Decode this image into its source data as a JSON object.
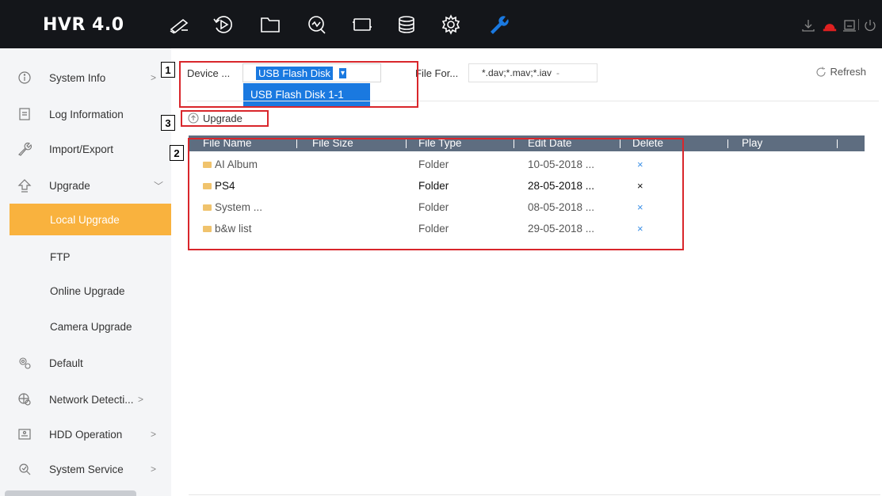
{
  "app": {
    "logo": "HVR 4.0"
  },
  "topbar": {
    "icons": [
      "live-view-icon",
      "playback-icon",
      "file-management-icon",
      "smart-analysis-icon",
      "video-wall-icon",
      "storage-icon",
      "settings-icon",
      "maintenance-icon"
    ],
    "right_icons": [
      "download-icon",
      "alarm-icon",
      "notification-icon",
      "power-icon"
    ],
    "active_color": "#1a79e0",
    "alarm_color": "#e02020"
  },
  "sidebar": {
    "items": [
      {
        "label": "System Info",
        "icon": "info-icon",
        "arrow": ">"
      },
      {
        "label": "Log Information",
        "icon": "log-icon",
        "arrow": ""
      },
      {
        "label": "Import/Export",
        "icon": "import-export-icon",
        "arrow": ""
      },
      {
        "label": "Upgrade",
        "icon": "upgrade-icon",
        "arrow": "﹀"
      },
      {
        "label": "Local Upgrade",
        "icon": "",
        "arrow": ""
      },
      {
        "label": "FTP",
        "icon": "",
        "arrow": ""
      },
      {
        "label": "Online Upgrade",
        "icon": "",
        "arrow": ""
      },
      {
        "label": "Camera Upgrade",
        "icon": "",
        "arrow": ""
      },
      {
        "label": "Default",
        "icon": "default-icon",
        "arrow": ""
      },
      {
        "label": "Network Detecti...",
        "icon": "network-detection-icon",
        "arrow": ">"
      },
      {
        "label": "HDD Operation",
        "icon": "hdd-icon",
        "arrow": ">"
      },
      {
        "label": "System Service",
        "icon": "system-service-icon",
        "arrow": ">"
      }
    ],
    "active_color": "#f9b23e"
  },
  "toolbar": {
    "device_label": "Device ...",
    "device_value": "USB Flash Disk",
    "device_option": "USB Flash Disk 1-1",
    "format_label": "File For...",
    "format_value": "*.dav;*.mav;*.iav",
    "refresh_label": "Refresh",
    "upgrade_label": "Upgrade"
  },
  "table": {
    "columns": [
      "File Name",
      "File Size",
      "File Type",
      "Edit Date",
      "Delete",
      "Play"
    ],
    "rows": [
      {
        "name": "AI Album",
        "size": "",
        "type": "Folder",
        "date": "10-05-2018 ...",
        "delete": "×"
      },
      {
        "name": "PS4",
        "size": "",
        "type": "Folder",
        "date": "28-05-2018 ...",
        "delete": "×"
      },
      {
        "name": "System ...",
        "size": "",
        "type": "Folder",
        "date": "08-05-2018 ...",
        "delete": "×"
      },
      {
        "name": "b&w list",
        "size": "",
        "type": "Folder",
        "date": "29-05-2018 ...",
        "delete": "×"
      }
    ]
  },
  "annotations": [
    {
      "number": "1"
    },
    {
      "number": "2"
    },
    {
      "number": "3"
    }
  ]
}
